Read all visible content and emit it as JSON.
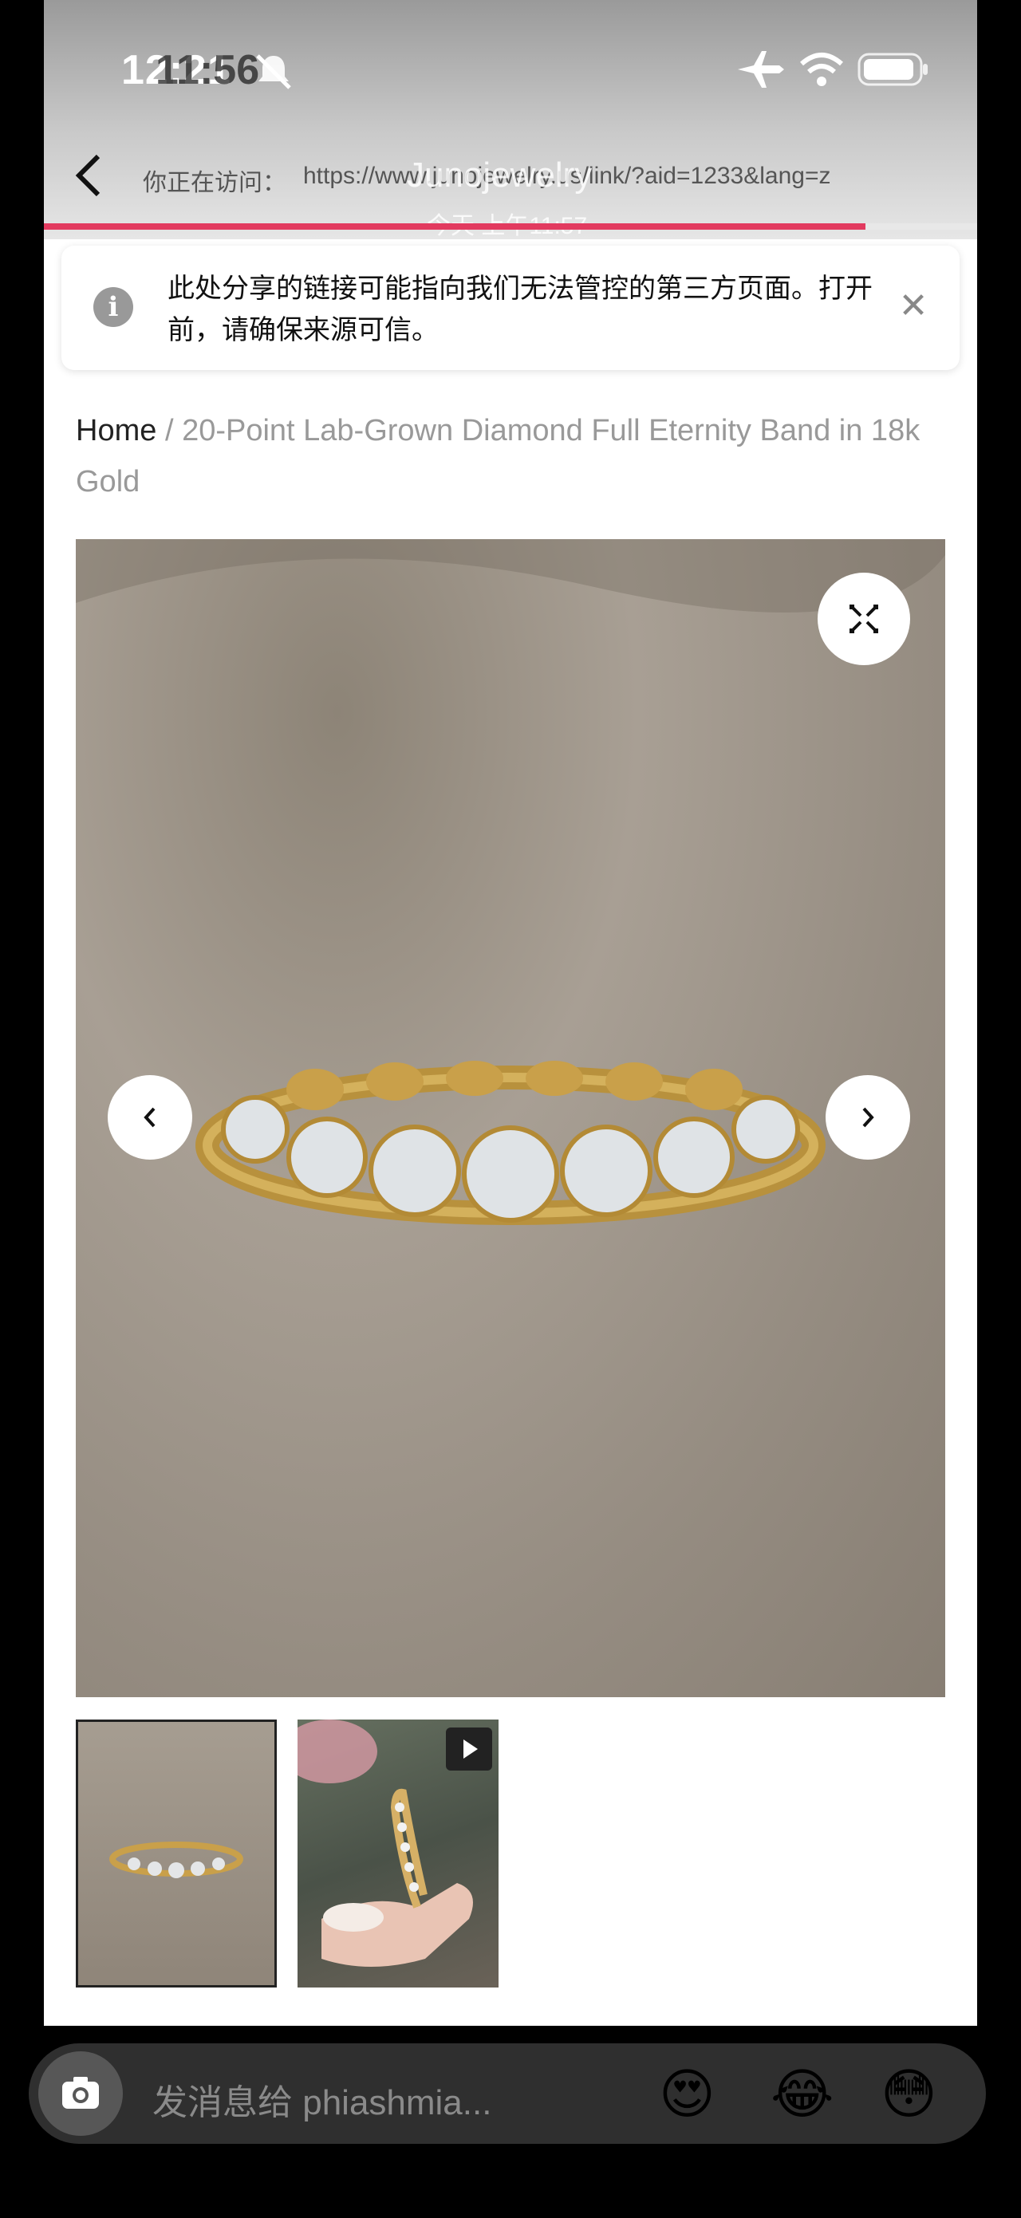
{
  "status_bar": {
    "time_primary": "12:21",
    "time_secondary": "11:56"
  },
  "browser": {
    "visit_label": "你正在访问：",
    "url": "https://www.junojewelry.us/link/?aid=1233&lang=z",
    "overlay_title": "Junojewelry",
    "overlay_time": "今天 上午11:57",
    "progress_percent": 88
  },
  "notice": {
    "text": "此处分享的链接可能指向我们无法管控的第三方页面。打开前，请确保来源可信。",
    "close_icon": "close-icon"
  },
  "breadcrumb": {
    "home": "Home",
    "separator": "/",
    "current": "20-Point Lab-Grown Diamond Full Eternity Band in 18k Gold"
  },
  "message_bar": {
    "placeholder": "发消息给 phiashmia...",
    "emojis": [
      "😍",
      "😂",
      "😳"
    ]
  }
}
